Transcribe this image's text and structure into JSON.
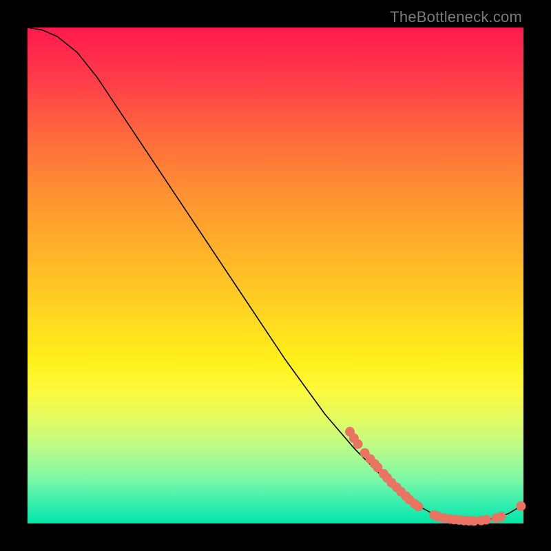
{
  "attribution": "TheBottleneck.com",
  "chart_data": {
    "type": "line",
    "title": "",
    "xlabel": "",
    "ylabel": "",
    "xlim": [
      0,
      100
    ],
    "ylim": [
      0,
      100
    ],
    "curve": [
      {
        "x": 0,
        "y": 100
      },
      {
        "x": 3,
        "y": 99.5
      },
      {
        "x": 6,
        "y": 98.2
      },
      {
        "x": 10,
        "y": 95
      },
      {
        "x": 14,
        "y": 90
      },
      {
        "x": 20,
        "y": 81
      },
      {
        "x": 28,
        "y": 69
      },
      {
        "x": 36,
        "y": 57
      },
      {
        "x": 44,
        "y": 45
      },
      {
        "x": 52,
        "y": 33
      },
      {
        "x": 60,
        "y": 22
      },
      {
        "x": 66,
        "y": 15
      },
      {
        "x": 72,
        "y": 9
      },
      {
        "x": 78,
        "y": 4
      },
      {
        "x": 82,
        "y": 1.8
      },
      {
        "x": 86,
        "y": 0.8
      },
      {
        "x": 90,
        "y": 0.5
      },
      {
        "x": 94,
        "y": 1.0
      },
      {
        "x": 97,
        "y": 2.0
      },
      {
        "x": 100,
        "y": 3.8
      }
    ],
    "markers": [
      {
        "x": 65,
        "y": 18.5
      },
      {
        "x": 65.8,
        "y": 17.2
      },
      {
        "x": 66.6,
        "y": 16.0
      },
      {
        "x": 68.0,
        "y": 14.2
      },
      {
        "x": 69.1,
        "y": 13.0
      },
      {
        "x": 70.0,
        "y": 12.0
      },
      {
        "x": 70.6,
        "y": 11.3
      },
      {
        "x": 71.8,
        "y": 10.0
      },
      {
        "x": 72.5,
        "y": 9.2
      },
      {
        "x": 73.4,
        "y": 8.2
      },
      {
        "x": 74.4,
        "y": 7.3
      },
      {
        "x": 75.3,
        "y": 6.4
      },
      {
        "x": 76.3,
        "y": 5.5
      },
      {
        "x": 77.0,
        "y": 4.8
      },
      {
        "x": 78.0,
        "y": 4.0
      },
      {
        "x": 78.8,
        "y": 3.4
      },
      {
        "x": 82.0,
        "y": 1.7
      },
      {
        "x": 82.8,
        "y": 1.4
      },
      {
        "x": 84.0,
        "y": 1.1
      },
      {
        "x": 85.2,
        "y": 0.9
      },
      {
        "x": 86.0,
        "y": 0.8
      },
      {
        "x": 87.0,
        "y": 0.7
      },
      {
        "x": 88.0,
        "y": 0.6
      },
      {
        "x": 89.0,
        "y": 0.55
      },
      {
        "x": 90.0,
        "y": 0.5
      },
      {
        "x": 91.5,
        "y": 0.6
      },
      {
        "x": 92.5,
        "y": 0.75
      },
      {
        "x": 94.5,
        "y": 1.1
      },
      {
        "x": 95.5,
        "y": 1.4
      },
      {
        "x": 99.5,
        "y": 3.5
      }
    ],
    "marker_radius": 7,
    "colors": {
      "curve": "#000000",
      "marker": "#e87461",
      "gradient_top": "#ff1a4d",
      "gradient_bottom": "#00e6a8"
    }
  }
}
